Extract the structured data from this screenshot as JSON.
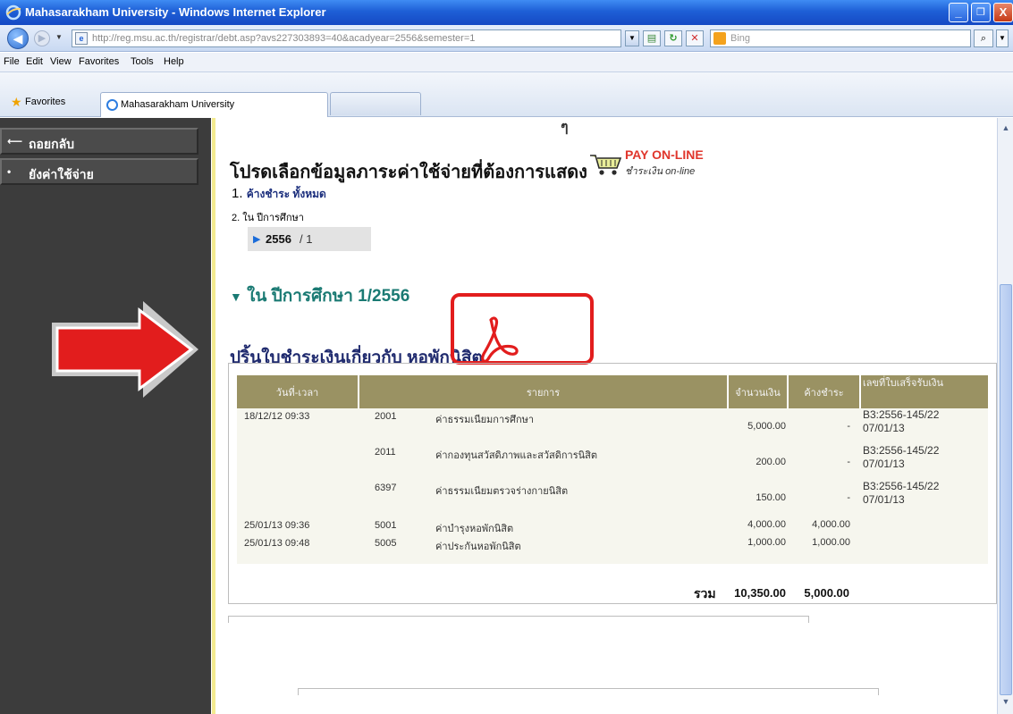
{
  "window": {
    "title": "Mahasarakham University - Windows Internet Explorer",
    "controls": {
      "minimize": "_",
      "maximize": "❐",
      "close": "X"
    }
  },
  "address_bar": {
    "url": "http://reg.msu.ac.th/registrar/debt.asp?avs227303893=40&acadyear=2556&semester=1",
    "search_placeholder": "Bing"
  },
  "menu": [
    "File",
    "Edit",
    "View",
    "Favorites",
    "Tools",
    "Help"
  ],
  "favorites_bar": {
    "favorites_label": "Favorites",
    "tab_label": "Mahasarakham University"
  },
  "sidebar": {
    "items": [
      {
        "icon": "arrow-left-icon",
        "label": "ถอยกลับ"
      },
      {
        "icon": "bullet-icon",
        "label": "ยังค่าใช้จ่าย"
      }
    ]
  },
  "content": {
    "top_glyph": "ๆ",
    "heading": "โปรดเลือกข้อมูลภาระค่าใช้จ่ายที่ต้องการแสดง",
    "pay_online": {
      "main": "PAY ON-LINE",
      "sub": "ชำระเงิน on-line"
    },
    "option1": {
      "number": "1.",
      "link": "ค้างชำระ ทั้งหมด"
    },
    "option2": "2. ใน ปีการศึกษา",
    "term": {
      "year": "2556",
      "semester": "/ 1"
    },
    "section_title": "ใน ปีการศึกษา 1/2556",
    "print_title": "ปริ้นใบชำระเงินเกี่ยวกับ หอพักนิสิต",
    "table": {
      "headers": [
        "วันที่-เวลา",
        "รายการ",
        "จำนวนเงิน",
        "ค้างชำระ",
        "เลขที่ใบเสร็จรับเงิน"
      ],
      "rows": [
        {
          "date": "18/12/12 09:33",
          "code": "2001",
          "desc": "ค่าธรรมเนียมการศึกษา",
          "amount": "5,000.00",
          "outstanding": "-",
          "receipt": "B3:2556-145/22 07/01/13"
        },
        {
          "date": "",
          "code": "2011",
          "desc": "ค่ากองทุนสวัสดิภาพและสวัสดิการนิสิต",
          "amount": "200.00",
          "outstanding": "-",
          "receipt": "B3:2556-145/22 07/01/13"
        },
        {
          "date": "",
          "code": "6397",
          "desc": "ค่าธรรมเนียมตรวจร่างกายนิสิต",
          "amount": "150.00",
          "outstanding": "-",
          "receipt": "B3:2556-145/22 07/01/13"
        },
        {
          "date": "25/01/13 09:36",
          "code": "5001",
          "desc": "ค่าบำรุงหอพักนิสิต",
          "amount": "4,000.00",
          "outstanding": "4,000.00",
          "receipt": ""
        },
        {
          "date": "25/01/13 09:48",
          "code": "5005",
          "desc": "ค่าประกันหอพักนิสิต",
          "amount": "1,000.00",
          "outstanding": "1,000.00",
          "receipt": ""
        }
      ],
      "total_label": "รวม",
      "total_amount": "10,350.00",
      "total_outstanding": "5,000.00"
    }
  },
  "colors": {
    "titlebar": "#1e5fd6",
    "sidebar": "#3c3c3c",
    "table_header": "#9a9263",
    "section_title": "#1a7a73",
    "annotation_red": "#e21d1d"
  }
}
